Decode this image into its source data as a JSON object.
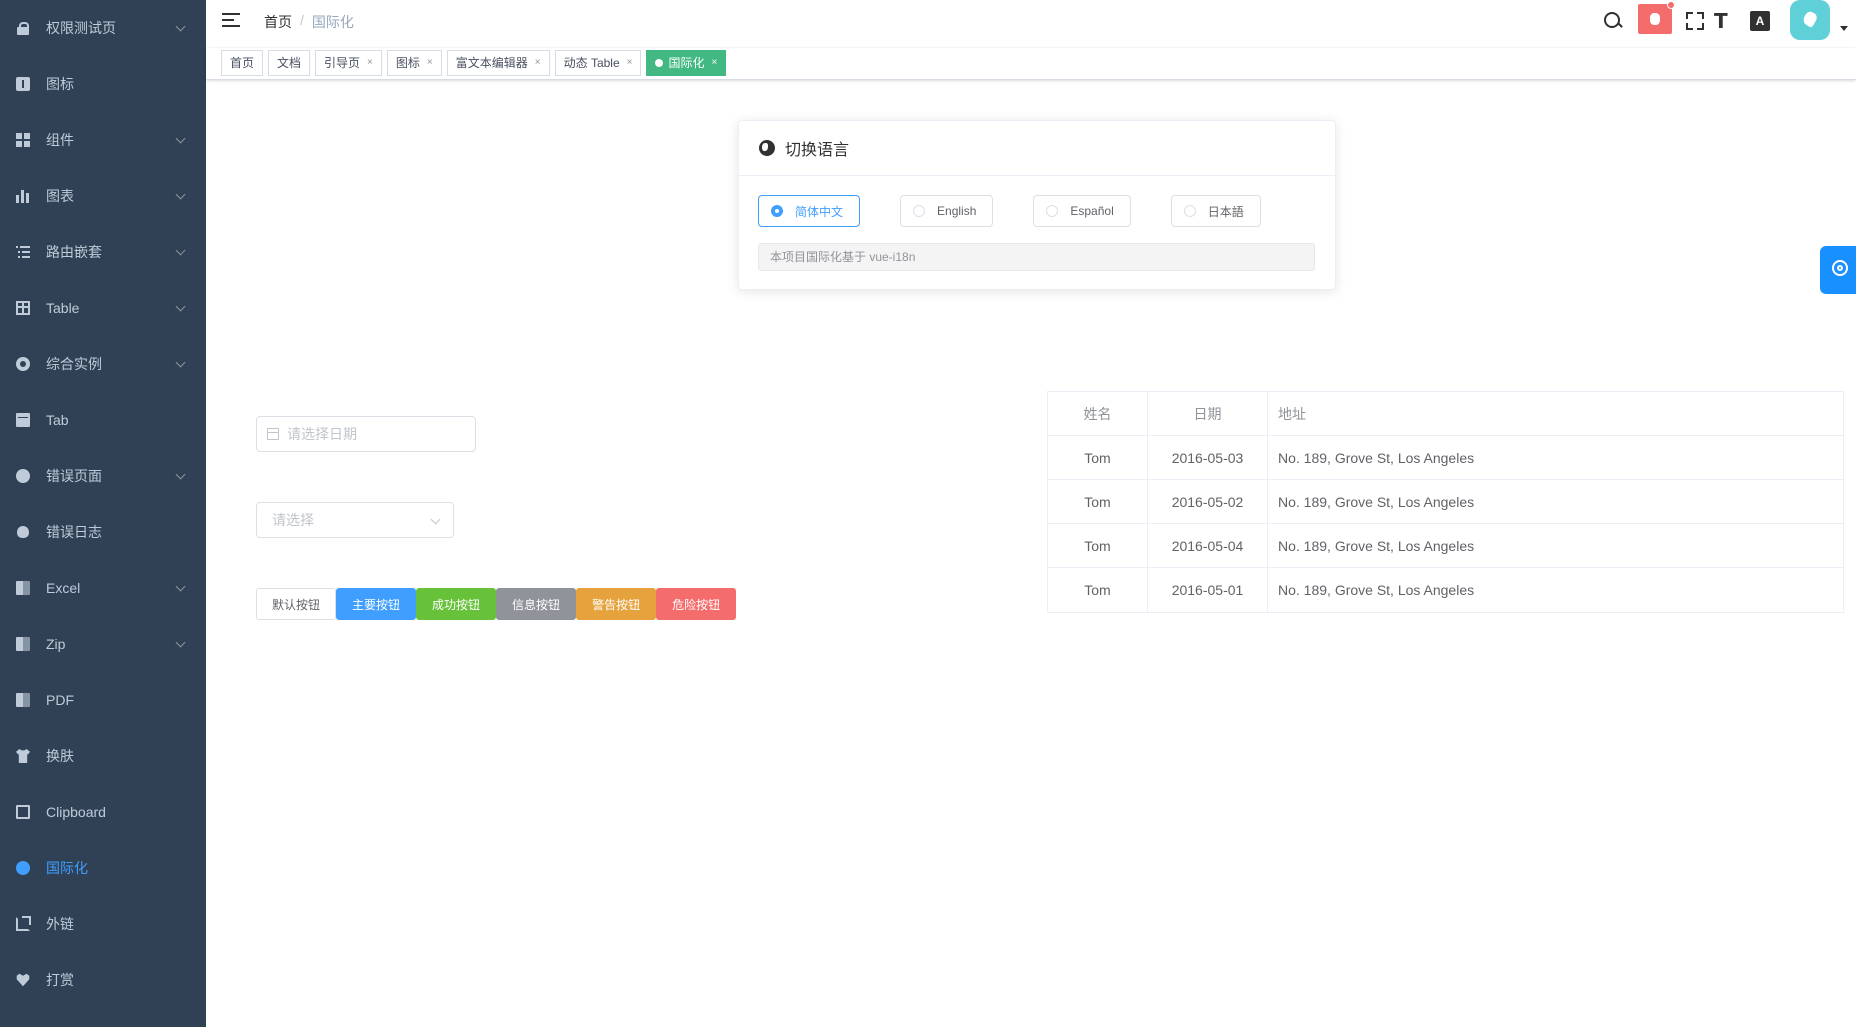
{
  "sidebar": {
    "items": [
      {
        "label": "权限测试页",
        "icon": "lock-icon",
        "has_children": true
      },
      {
        "label": "图标",
        "icon": "icon-icon",
        "has_children": false
      },
      {
        "label": "组件",
        "icon": "component-icon",
        "has_children": true
      },
      {
        "label": "图表",
        "icon": "chart-icon",
        "has_children": true
      },
      {
        "label": "路由嵌套",
        "icon": "nested-icon",
        "has_children": true
      },
      {
        "label": "Table",
        "icon": "table-icon",
        "has_children": true
      },
      {
        "label": "综合实例",
        "icon": "example-icon",
        "has_children": true
      },
      {
        "label": "Tab",
        "icon": "tab-icon",
        "has_children": false
      },
      {
        "label": "错误页面",
        "icon": "404-icon",
        "has_children": true
      },
      {
        "label": "错误日志",
        "icon": "bug-icon",
        "has_children": false
      },
      {
        "label": "Excel",
        "icon": "excel-icon",
        "has_children": true
      },
      {
        "label": "Zip",
        "icon": "zip-icon",
        "has_children": true
      },
      {
        "label": "PDF",
        "icon": "pdf-icon",
        "has_children": false
      },
      {
        "label": "换肤",
        "icon": "skin-icon",
        "has_children": false
      },
      {
        "label": "Clipboard",
        "icon": "clipboard-icon",
        "has_children": false
      },
      {
        "label": "国际化",
        "icon": "international-icon",
        "has_children": false,
        "active": true
      },
      {
        "label": "外链",
        "icon": "link-icon",
        "has_children": false
      },
      {
        "label": "打赏",
        "icon": "donate-icon",
        "has_children": false
      }
    ]
  },
  "navbar": {
    "breadcrumb": {
      "home": "首页",
      "separator": "/",
      "current": "国际化"
    },
    "lang_icon_text": "A"
  },
  "tags": [
    {
      "label": "首页",
      "closable": false,
      "active": false
    },
    {
      "label": "文档",
      "closable": false,
      "active": false
    },
    {
      "label": "引导页",
      "closable": true,
      "active": false
    },
    {
      "label": "图标",
      "closable": true,
      "active": false
    },
    {
      "label": "富文本编辑器",
      "closable": true,
      "active": false
    },
    {
      "label": "动态 Table",
      "closable": true,
      "active": false
    },
    {
      "label": "国际化",
      "closable": true,
      "active": true
    }
  ],
  "tag_close_glyph": "×",
  "lang_card": {
    "title": "切换语言",
    "options": [
      "简体中文",
      "English",
      "Español",
      "日本語"
    ],
    "selected": "简体中文",
    "tip": "本项目国际化基于 vue-i18n"
  },
  "form": {
    "date_placeholder": "请选择日期",
    "select_placeholder": "请选择"
  },
  "buttons": [
    {
      "label": "默认按钮",
      "type": "default"
    },
    {
      "label": "主要按钮",
      "type": "primary"
    },
    {
      "label": "成功按钮",
      "type": "success"
    },
    {
      "label": "信息按钮",
      "type": "info"
    },
    {
      "label": "警告按钮",
      "type": "warning"
    },
    {
      "label": "危险按钮",
      "type": "danger"
    }
  ],
  "table": {
    "headers": [
      "姓名",
      "日期",
      "地址"
    ],
    "rows": [
      [
        "Tom",
        "2016-05-03",
        "No. 189, Grove St, Los Angeles"
      ],
      [
        "Tom",
        "2016-05-02",
        "No. 189, Grove St, Los Angeles"
      ],
      [
        "Tom",
        "2016-05-04",
        "No. 189, Grove St, Los Angeles"
      ],
      [
        "Tom",
        "2016-05-01",
        "No. 189, Grove St, Los Angeles"
      ]
    ]
  },
  "colors": {
    "sidebar_bg": "#304156",
    "accent": "#409eff",
    "active_tag": "#42b983",
    "danger": "#f56c6c"
  }
}
